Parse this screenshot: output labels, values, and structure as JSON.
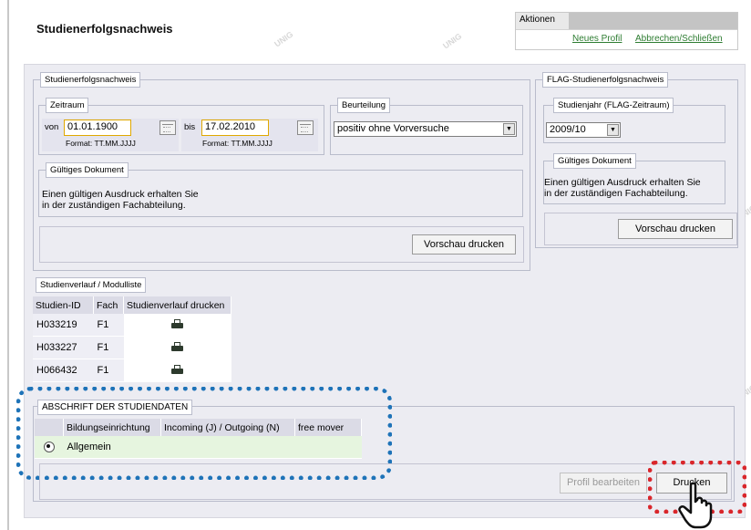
{
  "page": {
    "title": "Studienerfolgsnachweis"
  },
  "actions": {
    "label": "Aktionen",
    "new_profile": "Neues Profil",
    "cancel_close": "Abbrechen/Schließen"
  },
  "main_section": {
    "legend": "Studienerfolgsnachweis",
    "zeitraum": {
      "legend": "Zeitraum",
      "von_label": "von",
      "von_value": "01.01.1900",
      "bis_label": "bis",
      "bis_value": "17.02.2010",
      "format_hint": "Format: TT.MM.JJJJ"
    },
    "beurteilung": {
      "legend": "Beurteilung",
      "selected": "positiv ohne Vorversuche"
    },
    "gueltiges_dokument": {
      "legend": "Gültiges Dokument",
      "text_line1": "Einen gültigen Ausdruck erhalten Sie",
      "text_line2": "in der zuständigen Fachabteilung."
    },
    "preview_button": "Vorschau drucken"
  },
  "flag_section": {
    "legend": "FLAG-Studienerfolgsnachweis",
    "studienjahr": {
      "legend": "Studienjahr (FLAG-Zeitraum)",
      "selected": "2009/10"
    },
    "gueltiges_dokument": {
      "legend": "Gültiges Dokument",
      "text_line1": "Einen gültigen Ausdruck erhalten Sie",
      "text_line2": "in der zuständigen Fachabteilung."
    },
    "preview_button": "Vorschau drucken"
  },
  "studienverlauf": {
    "legend": "Studienverlauf / Modulliste",
    "columns": [
      "Studien-ID",
      "Fach",
      "Studienverlauf drucken"
    ],
    "rows": [
      {
        "id": "H033219",
        "fach": "F1",
        "print_icon": "printer-icon"
      },
      {
        "id": "H033227",
        "fach": "F1",
        "print_icon": "printer-icon"
      },
      {
        "id": "H066432",
        "fach": "F1",
        "print_icon": "printer-icon"
      }
    ]
  },
  "abschrift": {
    "legend": "ABSCHRIFT DER STUDIENDATEN",
    "columns": [
      "",
      "Bildungseinrichtung",
      "Incoming (J) / Outgoing (N)",
      "free mover"
    ],
    "rows": [
      {
        "selected": true,
        "name": "Allgemein",
        "incoming": "",
        "free_mover": ""
      }
    ]
  },
  "footer": {
    "edit_profile": "Profil bearbeiten",
    "print": "Drucken"
  },
  "colors": {
    "highlight_blue": "#1e73b8",
    "highlight_red": "#d9262b",
    "link_green": "#2e7d32",
    "date_border": "#e0a800"
  }
}
